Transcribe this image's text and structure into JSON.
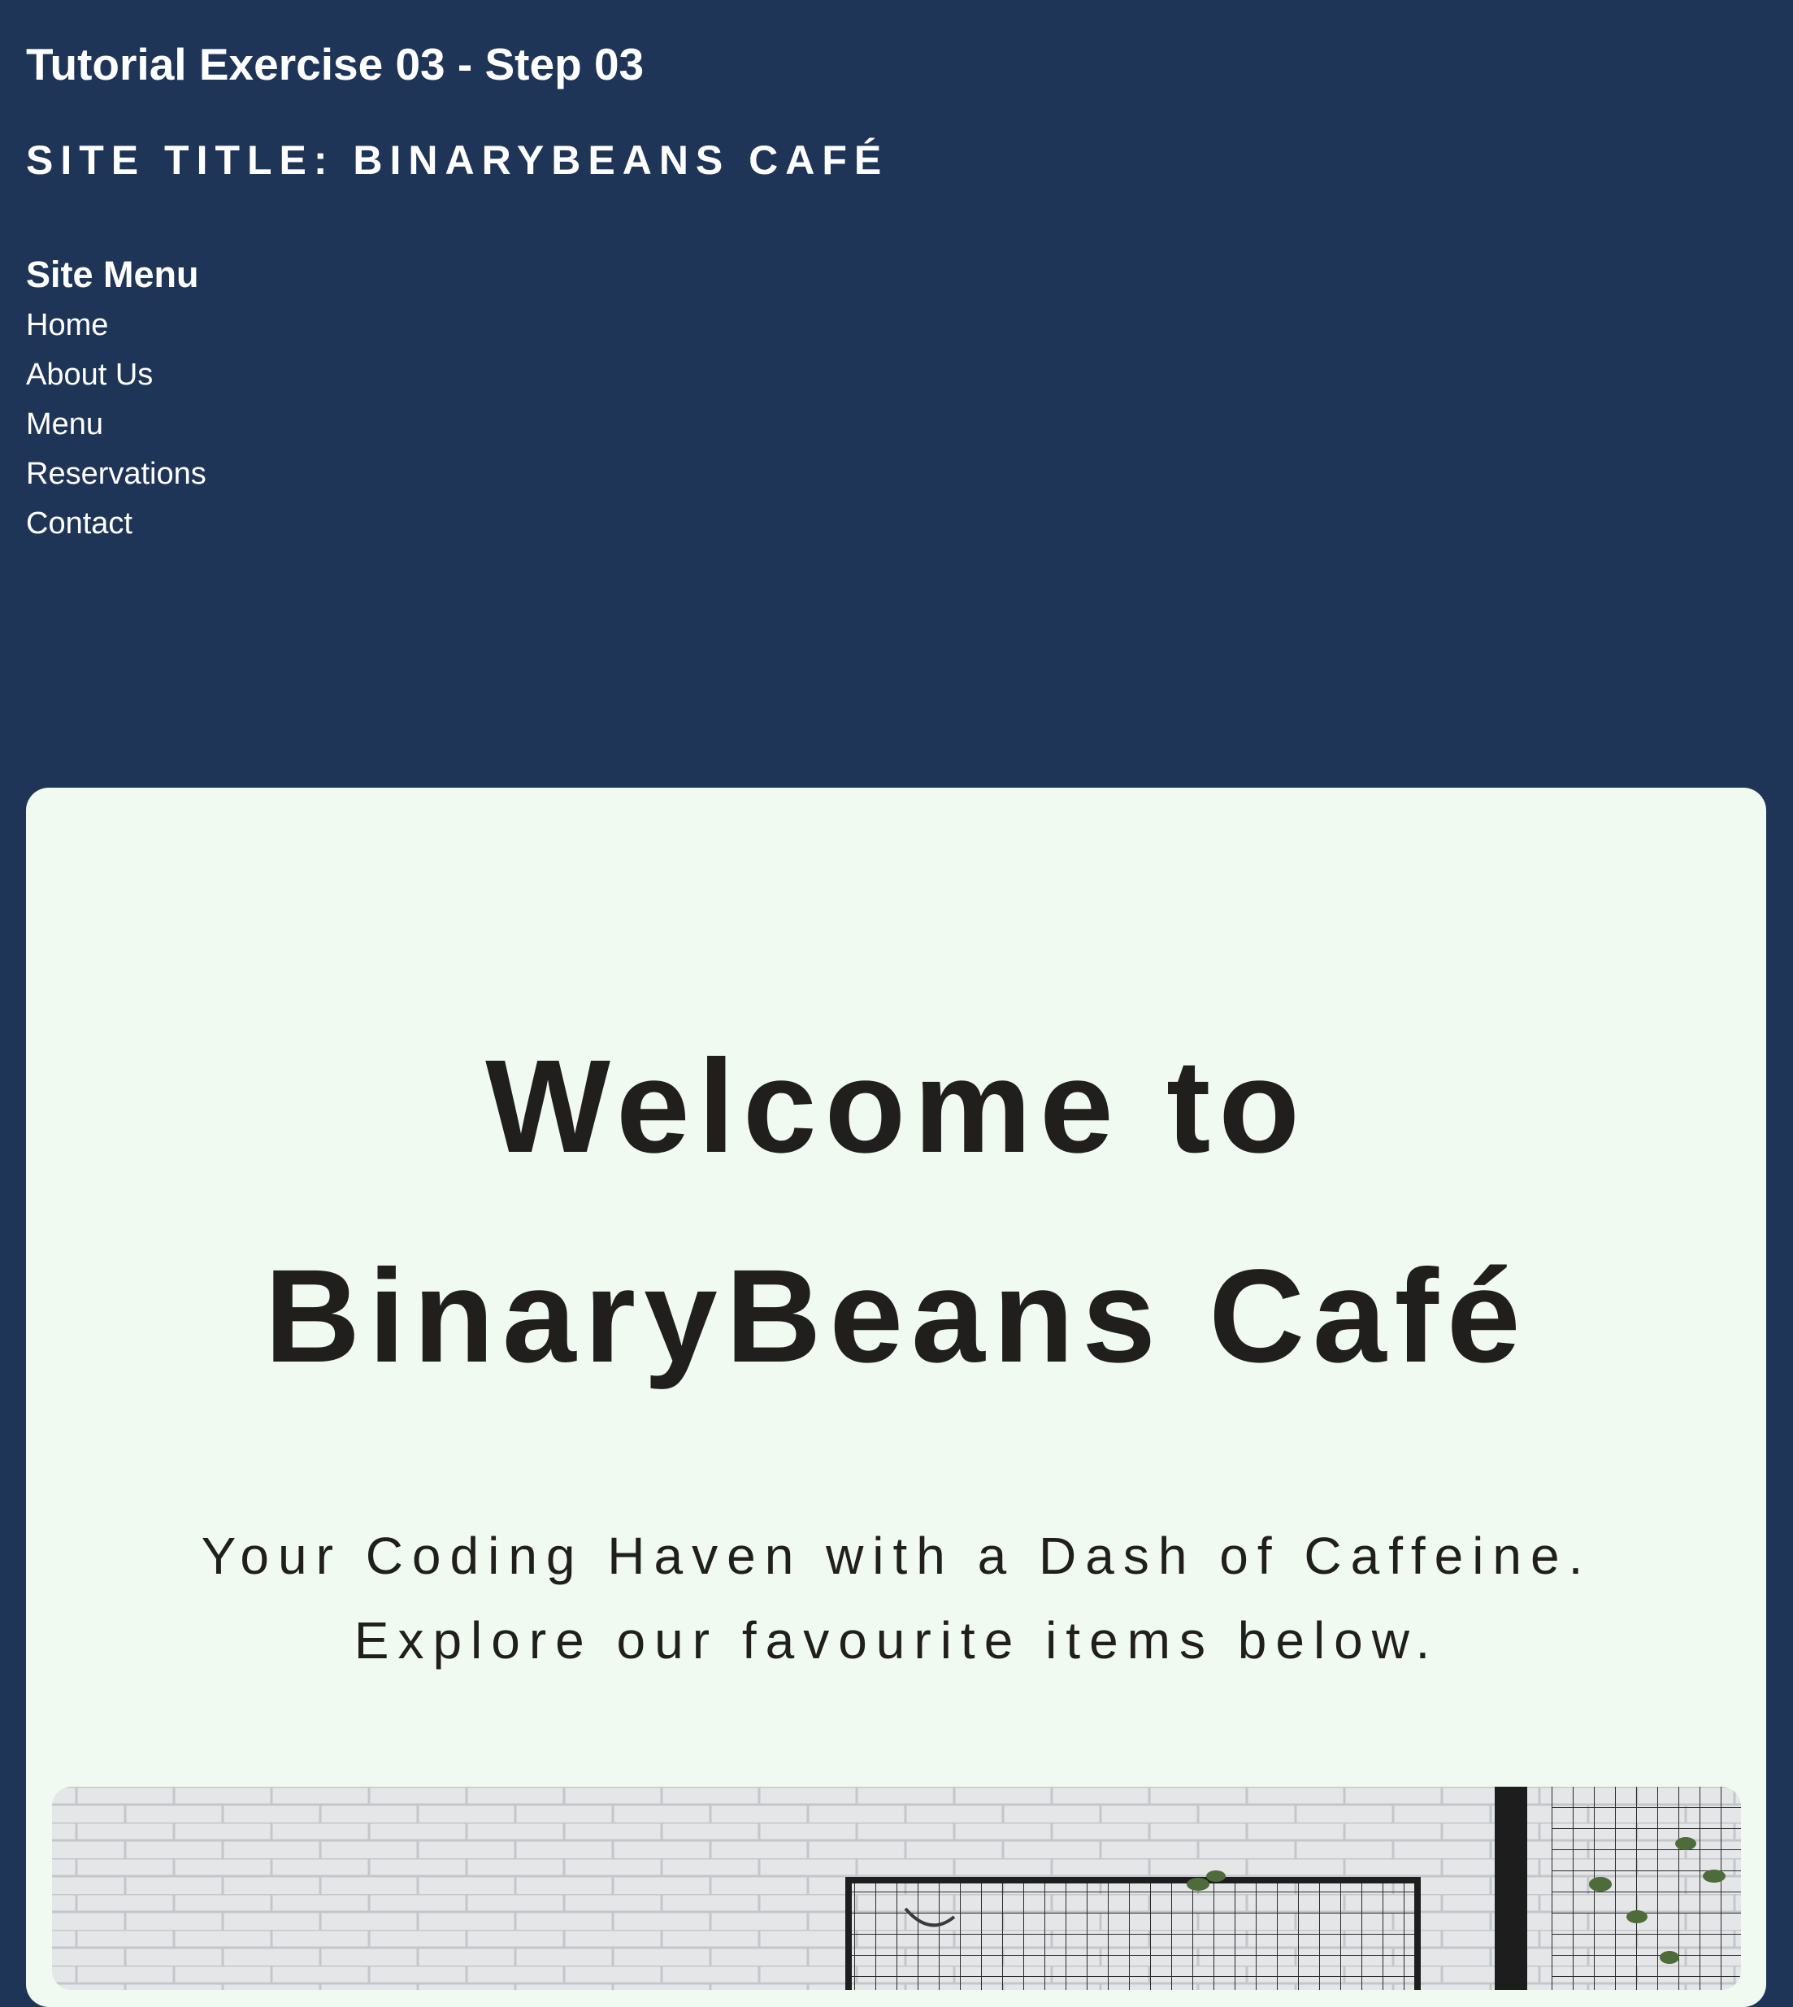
{
  "header": {
    "heading": "Tutorial Exercise 03 - Step 03",
    "site_title": "SITE TITLE: BINARYBEANS CAFÉ"
  },
  "site_menu": {
    "heading": "Site Menu",
    "items": [
      {
        "label": "Home"
      },
      {
        "label": "About Us"
      },
      {
        "label": "Menu"
      },
      {
        "label": "Reservations"
      },
      {
        "label": "Contact"
      }
    ]
  },
  "welcome": {
    "title_line1": "Welcome to",
    "title_line2": "BinaryBeans Café",
    "subtitle_line1": "Your Coding Haven with a Dash of Caffeine.",
    "subtitle_line2": "Explore our favourite items below."
  },
  "colors": {
    "page_background": "#1f3558",
    "panel_background": "#f1faf0",
    "heading_text": "#211f1d",
    "header_text": "#ffffff"
  },
  "image": {
    "subject": "cafe interior photo with white brick wall, black grid frame and hanging plants"
  }
}
